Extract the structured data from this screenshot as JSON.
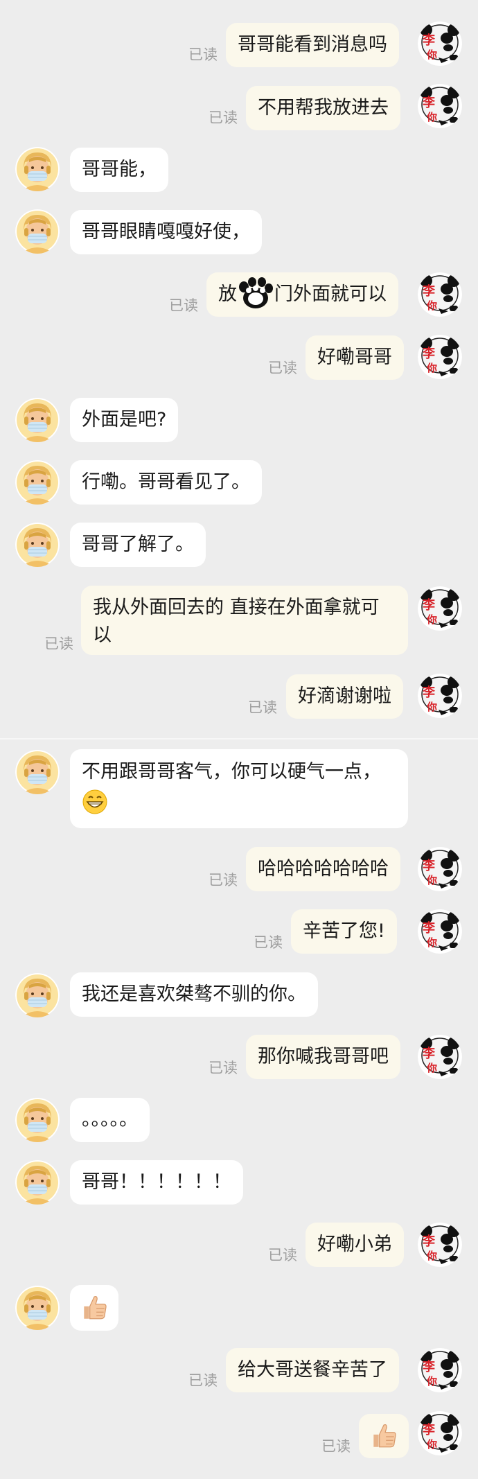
{
  "read_label": "已读",
  "messages": [
    {
      "side": "out",
      "text": "哥哥能看到消息吗",
      "read": true
    },
    {
      "side": "out",
      "text": "不用帮我放进去",
      "read": true
    },
    {
      "side": "in",
      "text": "哥哥能，"
    },
    {
      "side": "in",
      "text": "哥哥眼睛嘎嘎好使，"
    },
    {
      "side": "out",
      "text_a": "放",
      "text_b": "门外面就可以",
      "sticker": "paw-icon",
      "read": true
    },
    {
      "side": "out",
      "text": "好嘞哥哥",
      "read": true
    },
    {
      "side": "in",
      "text": "外面是吧?"
    },
    {
      "side": "in",
      "text": "行嘞。哥哥看见了。"
    },
    {
      "side": "in",
      "text": "哥哥了解了。"
    },
    {
      "side": "out",
      "text": "我从外面回去的 直接在外面拿就可以",
      "read": true
    },
    {
      "side": "out",
      "text": "好滴谢谢啦",
      "read": true
    },
    {
      "side": "in",
      "text": "不用跟哥哥客气，你可以硬气一点，",
      "emoji": "grin-emoji-icon"
    },
    {
      "side": "out",
      "text": "哈哈哈哈哈哈哈",
      "read": true
    },
    {
      "side": "out",
      "text": "辛苦了您!",
      "read": true
    },
    {
      "side": "in",
      "text": "我还是喜欢桀骜不驯的你。"
    },
    {
      "side": "out",
      "text": "那你喊我哥哥吧",
      "read": true
    },
    {
      "side": "in",
      "text": "。。。。。"
    },
    {
      "side": "in",
      "text": "哥哥！！！！！！"
    },
    {
      "side": "out",
      "text": "好嘞小弟",
      "read": true
    },
    {
      "side": "in",
      "emoji": "thumbs-up-emoji-icon"
    },
    {
      "side": "out",
      "text": "给大哥送餐辛苦了",
      "read": true
    },
    {
      "side": "out",
      "emoji": "thumbs-up-emoji-icon",
      "read": true
    }
  ],
  "colors": {
    "background": "#ededed",
    "incoming_bubble": "#ffffff",
    "outgoing_bubble": "#fbf8eb",
    "read_text": "#9e9e9e"
  },
  "avatars": {
    "incoming": "masked-person-avatar",
    "outgoing": "panda-meme-avatar"
  }
}
